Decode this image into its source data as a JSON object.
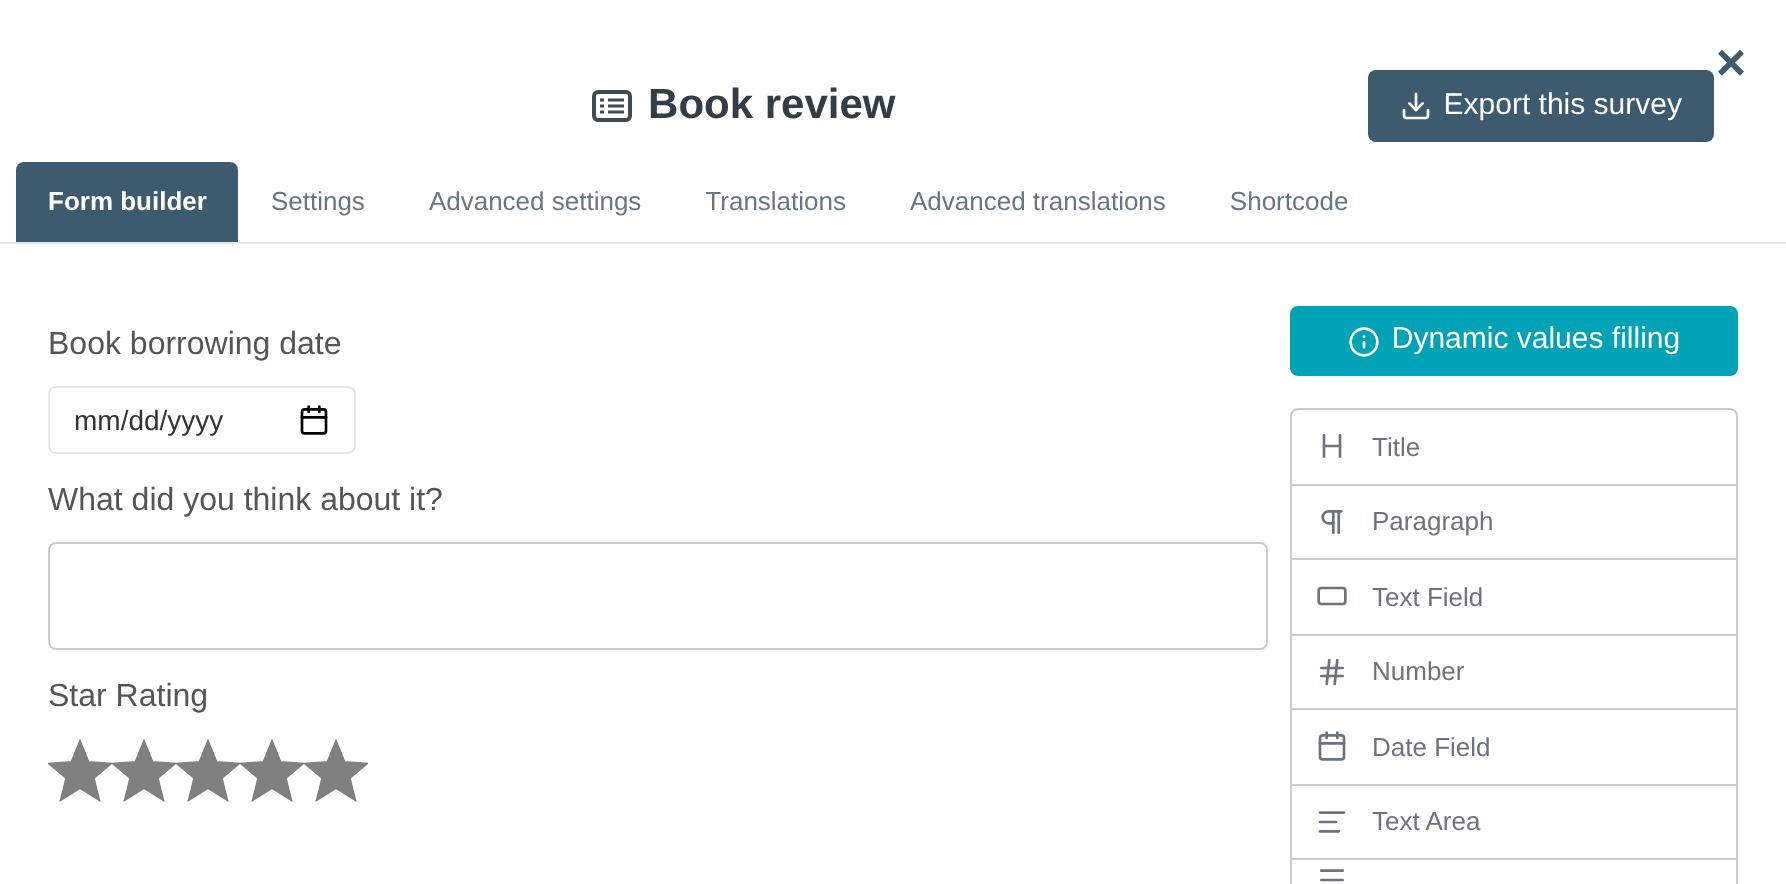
{
  "header": {
    "title": "Book review",
    "export_button": "Export this survey",
    "close": "×"
  },
  "tabs": [
    {
      "label": "Form builder",
      "selected": true
    },
    {
      "label": "Settings",
      "selected": false
    },
    {
      "label": "Advanced settings",
      "selected": false
    },
    {
      "label": "Translations",
      "selected": false
    },
    {
      "label": "Advanced translations",
      "selected": false
    },
    {
      "label": "Shortcode",
      "selected": false
    }
  ],
  "form": {
    "fields": [
      {
        "kind": "date",
        "label": "Book borrowing date",
        "placeholder": "mm/dd/yyyy"
      },
      {
        "kind": "textarea",
        "label": "What did you think about it?"
      },
      {
        "kind": "rating",
        "label": "Star Rating",
        "stars": 5
      }
    ]
  },
  "palette": {
    "button": "Dynamic values filling",
    "items": [
      {
        "kind": "title",
        "label": "Title"
      },
      {
        "kind": "paragraph",
        "label": "Paragraph"
      },
      {
        "kind": "textfield",
        "label": "Text Field"
      },
      {
        "kind": "number",
        "label": "Number"
      },
      {
        "kind": "date",
        "label": "Date Field"
      },
      {
        "kind": "textarea",
        "label": "Text Area"
      },
      {
        "kind": "lines"
      }
    ]
  }
}
